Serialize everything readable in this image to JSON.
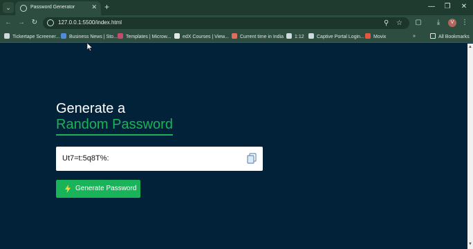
{
  "browser": {
    "tab_title": "Password Generator",
    "url": "127.0.0.1:5500/index.html",
    "bookmarks": [
      {
        "label": "Tickertape Screener...",
        "color": "#cfd8dc"
      },
      {
        "label": "Business News | Sto...",
        "color": "#4f8bd6"
      },
      {
        "label": "Templates | Microw...",
        "color": "#c64b6b"
      },
      {
        "label": "edX Courses | View...",
        "color": "#dfe8e2"
      },
      {
        "label": "Current time in India",
        "color": "#e46a5b"
      },
      {
        "label": "1:12",
        "color": "#cfd8dc"
      },
      {
        "label": "Captive Portal Login...",
        "color": "#cfd8dc"
      },
      {
        "label": "Movix",
        "color": "#e2583e"
      }
    ],
    "all_bookmarks": "All Bookmarks",
    "avatar_letter": "V"
  },
  "app": {
    "heading_line1": "Generate a",
    "heading_line2": "Random Password",
    "password": "Ut7=t:5q8T%:",
    "generate_label": "Generate Password",
    "accent_color": "#19b35a",
    "background_color": "#02223a"
  }
}
